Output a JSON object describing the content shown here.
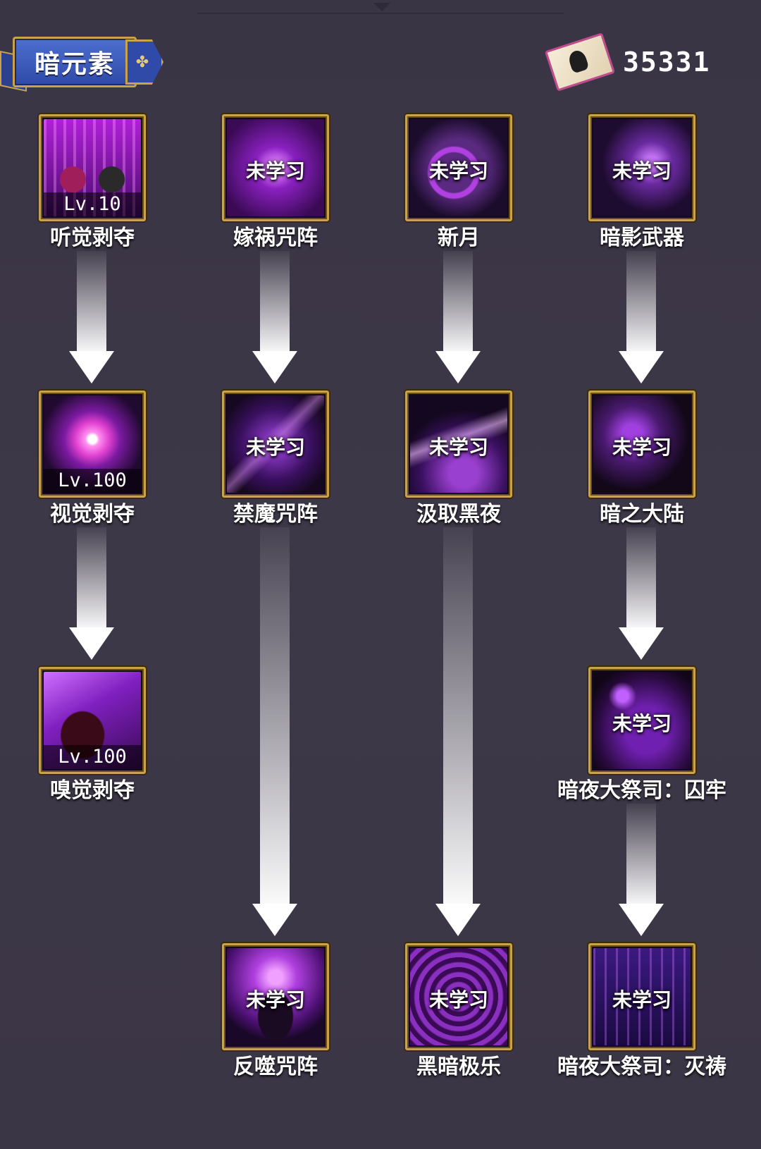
{
  "header": {
    "title": "暗元素"
  },
  "currency": {
    "value": "35331",
    "icon": "spell-scroll-icon"
  },
  "status": {
    "locked": "未学习"
  },
  "skills": [
    {
      "name": "听觉剥夺",
      "level": "Lv.10",
      "icon": "hands-icon"
    },
    {
      "name": "嫁祸咒阵",
      "icon": "magic-circle-icon"
    },
    {
      "name": "新月",
      "icon": "crescent-moon-icon"
    },
    {
      "name": "暗影武器",
      "icon": "shadow-weapon-icon"
    },
    {
      "name": "视觉剥夺",
      "level": "Lv.100",
      "icon": "eye-icon"
    },
    {
      "name": "禁魔咒阵",
      "icon": "seal-circle-icon"
    },
    {
      "name": "汲取黑夜",
      "icon": "night-drain-icon"
    },
    {
      "name": "暗之大陆",
      "icon": "dark-land-icon"
    },
    {
      "name": "嗅觉剥夺",
      "level": "Lv.100",
      "icon": "crouching-figure-icon"
    },
    {
      "name": "暗夜大祭司：囚牢",
      "icon": "prison-icon"
    },
    {
      "name": "反噬咒阵",
      "icon": "raised-arms-figure-icon"
    },
    {
      "name": "黑暗极乐",
      "icon": "vortex-icon"
    },
    {
      "name": "暗夜大祭司：灭祷",
      "icon": "dark-rain-icon"
    }
  ]
}
